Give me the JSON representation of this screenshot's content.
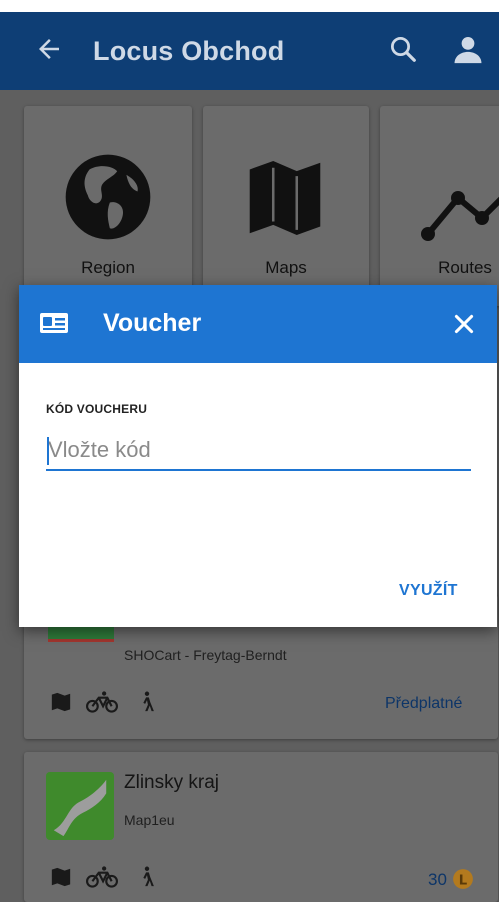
{
  "app_bar": {
    "title": "Locus Obchod",
    "back_icon": "arrow-left-icon",
    "search_icon": "search-icon",
    "account_icon": "account-icon"
  },
  "categories": [
    {
      "label": "Region",
      "icon": "globe-icon"
    },
    {
      "label": "Maps",
      "icon": "map-icon"
    },
    {
      "label": "Routes",
      "icon": "route-icon"
    }
  ],
  "items": [
    {
      "title": "",
      "subtitle": "SHOCart - Freytag-Berndt",
      "action": "Předplatné"
    },
    {
      "title": "Zlinsky kraj",
      "subtitle": "Map1eu",
      "action": "30"
    }
  ],
  "dialog": {
    "title": "Voucher",
    "field_label": "KÓD VOUCHERU",
    "field_value": "",
    "field_placeholder": "Vložte kód",
    "action_label": "VYUŽÍT"
  },
  "colors": {
    "app_bar": "#0e3e75",
    "dialog_header": "#1e75d2",
    "accent": "#1e75d2"
  }
}
